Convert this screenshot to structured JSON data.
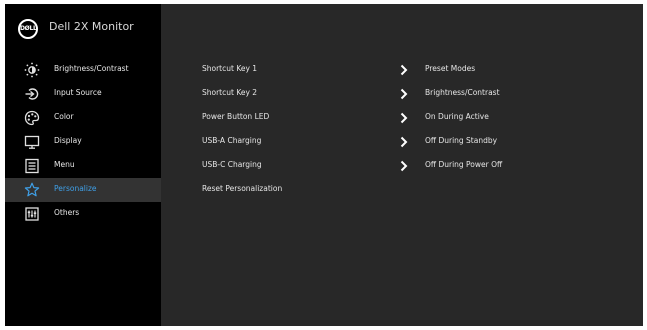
{
  "header": {
    "logo_text": "DØLL",
    "model": "Dell 2X Monitor"
  },
  "sidebar": {
    "items": [
      {
        "label": "Brightness/Contrast",
        "icon": "brightness-icon"
      },
      {
        "label": "Input Source",
        "icon": "input-source-icon"
      },
      {
        "label": "Color",
        "icon": "color-icon"
      },
      {
        "label": "Display",
        "icon": "display-icon"
      },
      {
        "label": "Menu",
        "icon": "menu-icon"
      },
      {
        "label": "Personalize",
        "icon": "star-icon",
        "selected": true
      },
      {
        "label": "Others",
        "icon": "others-icon"
      }
    ]
  },
  "main": {
    "rows": [
      {
        "label": "Shortcut Key 1",
        "value": "Preset Modes",
        "has_arrow": true
      },
      {
        "label": "Shortcut Key 2",
        "value": "Brightness/Contrast",
        "has_arrow": true
      },
      {
        "label": "Power Button LED",
        "value": "On During Active",
        "has_arrow": true
      },
      {
        "label": "USB-A Charging",
        "value": "Off During Standby",
        "has_arrow": true
      },
      {
        "label": "USB-C Charging",
        "value": "Off During Power Off",
        "has_arrow": true
      },
      {
        "label": "Reset Personalization",
        "value": "",
        "has_arrow": false
      }
    ]
  },
  "colors": {
    "sidebar_bg": "#000000",
    "content_bg": "#282828",
    "selected_bg": "#333333",
    "accent": "#3fa0e8",
    "text": "#e6e6e6"
  }
}
